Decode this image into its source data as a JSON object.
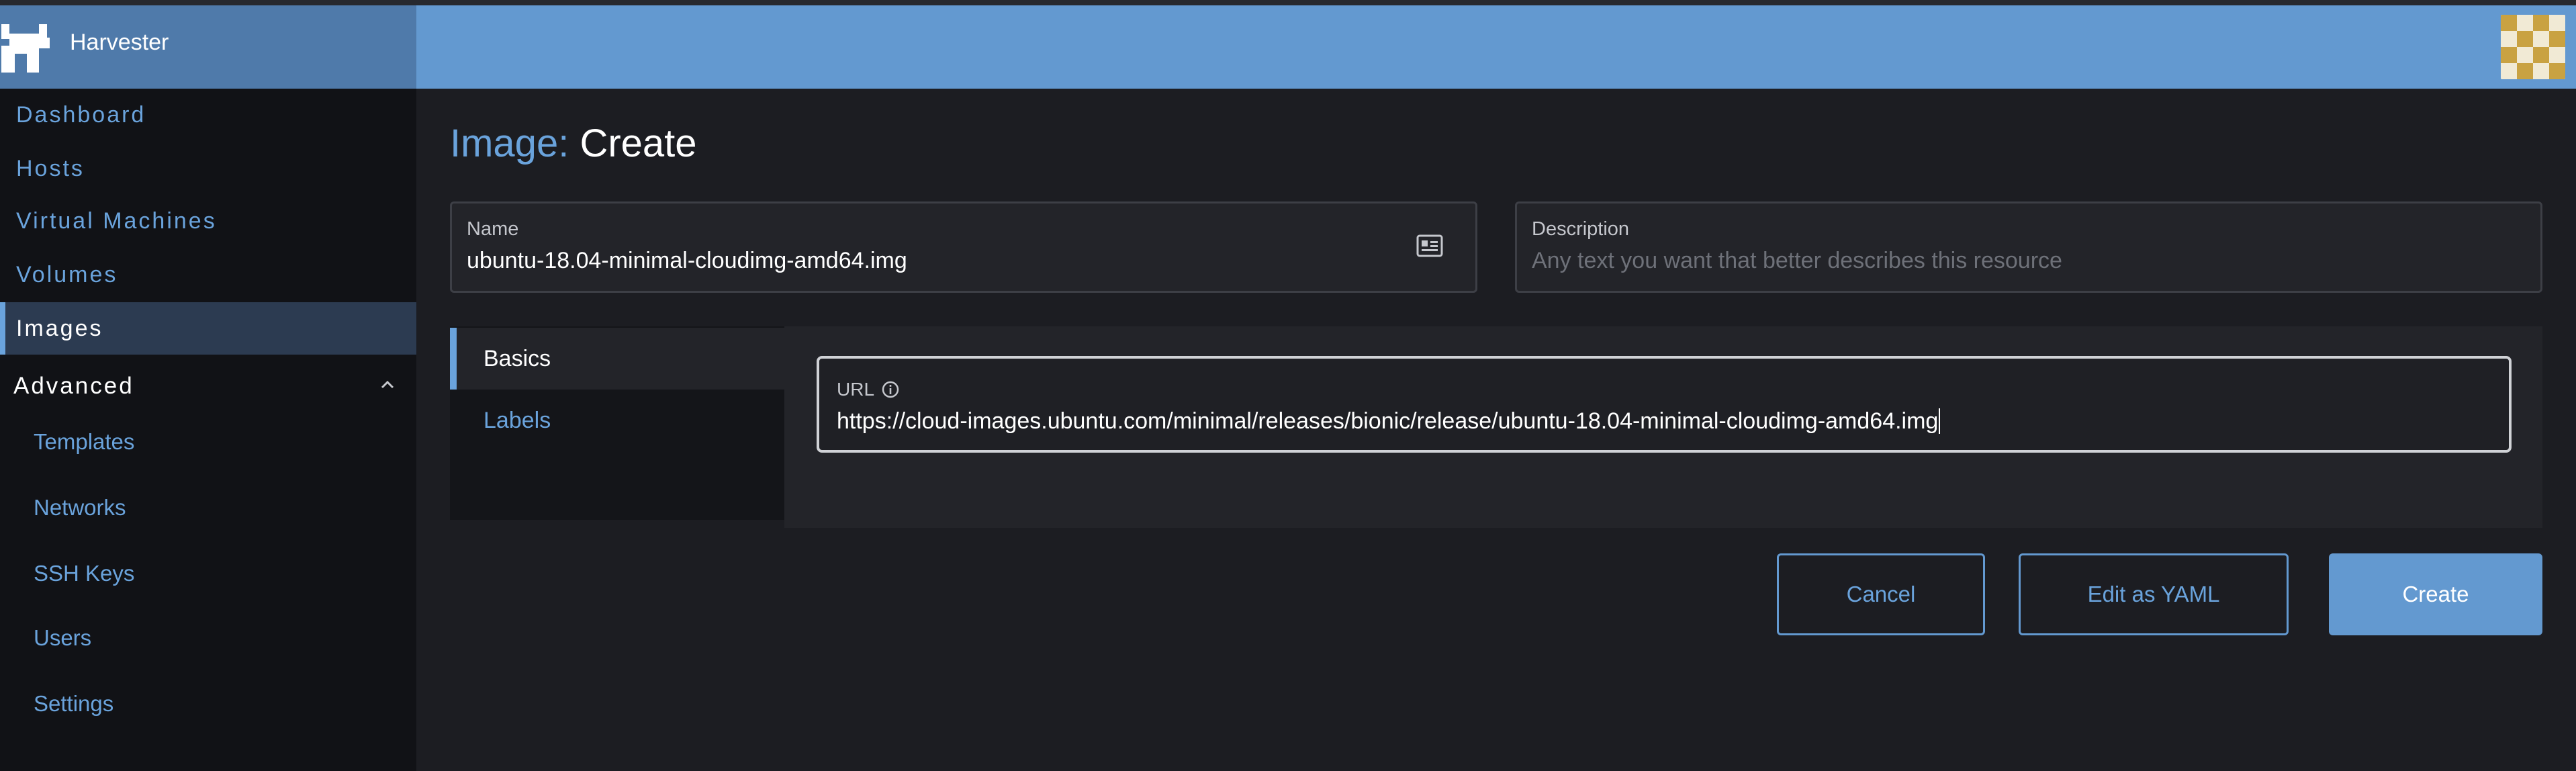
{
  "brand": {
    "name": "Harvester",
    "logo_icon": "harvester-logo-icon"
  },
  "header": {
    "avatar_icon": "user-avatar-icon"
  },
  "sidebar": {
    "items": [
      {
        "label": "Dashboard"
      },
      {
        "label": "Hosts"
      },
      {
        "label": "Virtual Machines"
      },
      {
        "label": "Volumes"
      },
      {
        "label": "Images"
      }
    ],
    "active_item": "Images",
    "group": {
      "label": "Advanced",
      "expanded": true,
      "items": [
        {
          "label": "Templates"
        },
        {
          "label": "Networks"
        },
        {
          "label": "SSH Keys"
        },
        {
          "label": "Users"
        },
        {
          "label": "Settings"
        }
      ]
    }
  },
  "page": {
    "title_prefix": "Image:",
    "title_action": "Create"
  },
  "form": {
    "name": {
      "label": "Name",
      "value": "ubuntu-18.04-minimal-cloudimg-amd64.img"
    },
    "description": {
      "label": "Description",
      "placeholder": "Any text you want that better describes this resource"
    },
    "tabs": [
      {
        "label": "Basics",
        "active": true
      },
      {
        "label": "Labels",
        "active": false
      }
    ],
    "url": {
      "label": "URL",
      "value": "https://cloud-images.ubuntu.com/minimal/releases/bionic/release/ubuntu-18.04-minimal-cloudimg-amd64.img"
    }
  },
  "actions": {
    "cancel_label": "Cancel",
    "yaml_label": "Edit as YAML",
    "create_label": "Create"
  },
  "colors": {
    "accent": "#6399d0",
    "link": "#6aa3dc",
    "sidebar_bg": "#111216",
    "main_bg": "#1c1d22"
  }
}
